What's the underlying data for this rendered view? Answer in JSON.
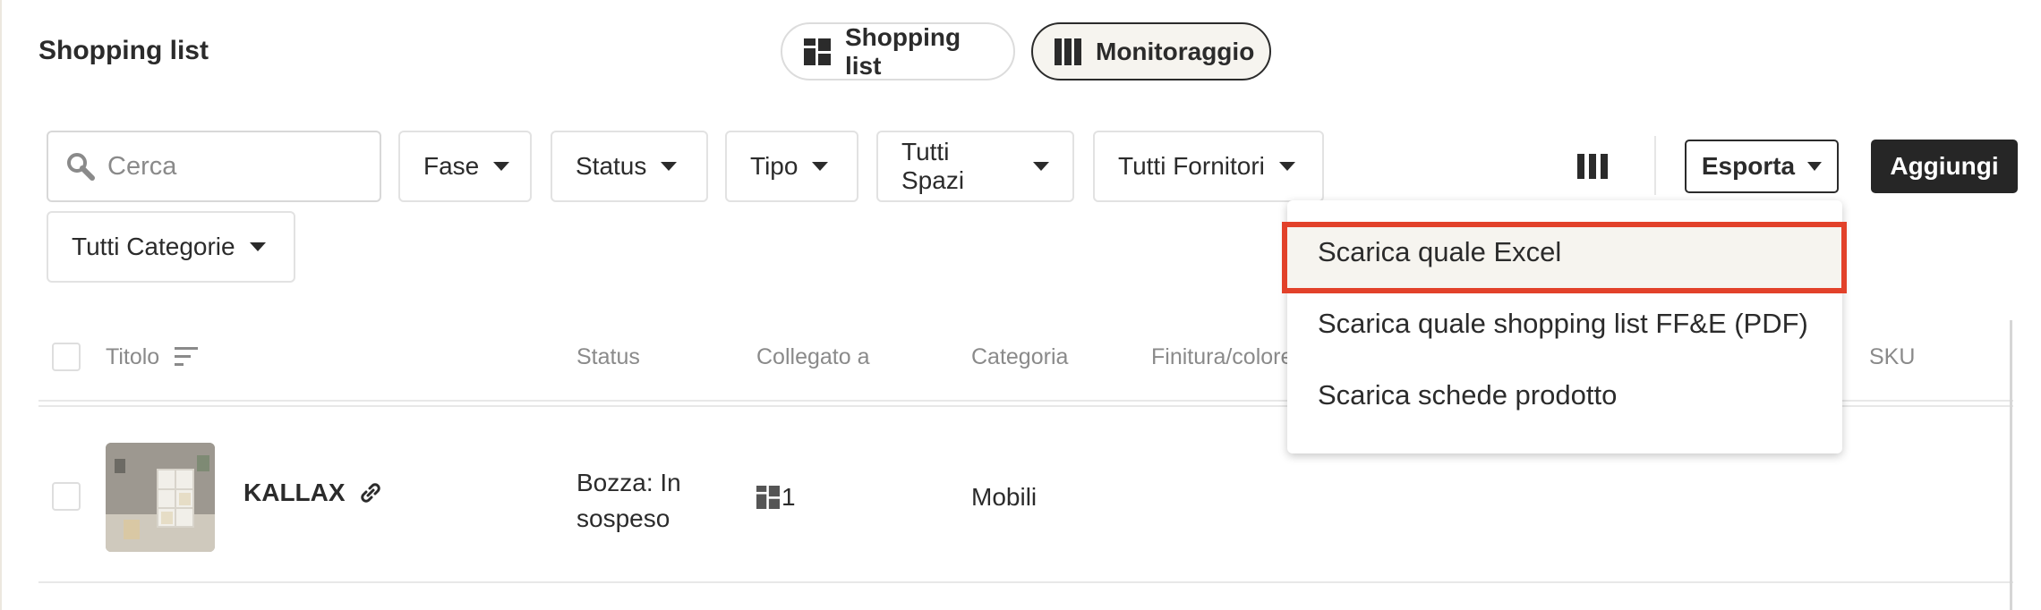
{
  "header": {
    "title": "Shopping list",
    "view_toggle": [
      {
        "label": "Shopping list",
        "icon": "grid-icon",
        "active": false
      },
      {
        "label": "Monitoraggio",
        "icon": "columns-icon",
        "active": true
      }
    ]
  },
  "toolbar": {
    "search_placeholder": "Cerca",
    "filters": [
      "Fase",
      "Status",
      "Tipo",
      "Tutti Spazi",
      "Tutti Fornitori",
      "Tutti Categorie"
    ],
    "export_label": "Esporta",
    "add_label": "Aggiungi"
  },
  "export_menu": {
    "items": [
      "Scarica quale Excel",
      "Scarica quale shopping list FF&E (PDF)",
      "Scarica schede prodotto"
    ],
    "highlighted_index": 0
  },
  "table": {
    "columns": [
      "Titolo",
      "Status",
      "Collegato a",
      "Categoria",
      "Finitura/colore",
      "SKU"
    ],
    "rows": [
      {
        "title": "KALLAX",
        "status_line1": "Bozza: In",
        "status_line2": "sospeso",
        "linked_count": "1",
        "category": "Mobili"
      }
    ]
  },
  "colors": {
    "accent": "#262626",
    "highlight_border": "#e2412a",
    "toggle_active_bg": "#f6f4ef"
  }
}
